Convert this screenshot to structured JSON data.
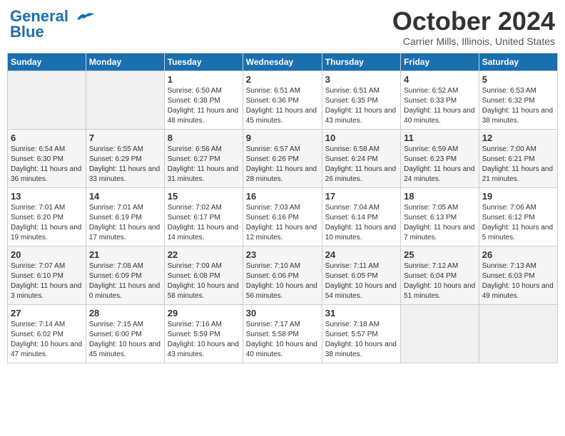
{
  "header": {
    "logo_general": "General",
    "logo_blue": "Blue",
    "month_title": "October 2024",
    "location": "Carrier Mills, Illinois, United States"
  },
  "days_of_week": [
    "Sunday",
    "Monday",
    "Tuesday",
    "Wednesday",
    "Thursday",
    "Friday",
    "Saturday"
  ],
  "weeks": [
    [
      {
        "day": "",
        "info": ""
      },
      {
        "day": "",
        "info": ""
      },
      {
        "day": "1",
        "info": "Sunrise: 6:50 AM\nSunset: 6:38 PM\nDaylight: 11 hours and 48 minutes."
      },
      {
        "day": "2",
        "info": "Sunrise: 6:51 AM\nSunset: 6:36 PM\nDaylight: 11 hours and 45 minutes."
      },
      {
        "day": "3",
        "info": "Sunrise: 6:51 AM\nSunset: 6:35 PM\nDaylight: 11 hours and 43 minutes."
      },
      {
        "day": "4",
        "info": "Sunrise: 6:52 AM\nSunset: 6:33 PM\nDaylight: 11 hours and 40 minutes."
      },
      {
        "day": "5",
        "info": "Sunrise: 6:53 AM\nSunset: 6:32 PM\nDaylight: 11 hours and 38 minutes."
      }
    ],
    [
      {
        "day": "6",
        "info": "Sunrise: 6:54 AM\nSunset: 6:30 PM\nDaylight: 11 hours and 36 minutes."
      },
      {
        "day": "7",
        "info": "Sunrise: 6:55 AM\nSunset: 6:29 PM\nDaylight: 11 hours and 33 minutes."
      },
      {
        "day": "8",
        "info": "Sunrise: 6:56 AM\nSunset: 6:27 PM\nDaylight: 11 hours and 31 minutes."
      },
      {
        "day": "9",
        "info": "Sunrise: 6:57 AM\nSunset: 6:26 PM\nDaylight: 11 hours and 28 minutes."
      },
      {
        "day": "10",
        "info": "Sunrise: 6:58 AM\nSunset: 6:24 PM\nDaylight: 11 hours and 26 minutes."
      },
      {
        "day": "11",
        "info": "Sunrise: 6:59 AM\nSunset: 6:23 PM\nDaylight: 11 hours and 24 minutes."
      },
      {
        "day": "12",
        "info": "Sunrise: 7:00 AM\nSunset: 6:21 PM\nDaylight: 11 hours and 21 minutes."
      }
    ],
    [
      {
        "day": "13",
        "info": "Sunrise: 7:01 AM\nSunset: 6:20 PM\nDaylight: 11 hours and 19 minutes."
      },
      {
        "day": "14",
        "info": "Sunrise: 7:01 AM\nSunset: 6:19 PM\nDaylight: 11 hours and 17 minutes."
      },
      {
        "day": "15",
        "info": "Sunrise: 7:02 AM\nSunset: 6:17 PM\nDaylight: 11 hours and 14 minutes."
      },
      {
        "day": "16",
        "info": "Sunrise: 7:03 AM\nSunset: 6:16 PM\nDaylight: 11 hours and 12 minutes."
      },
      {
        "day": "17",
        "info": "Sunrise: 7:04 AM\nSunset: 6:14 PM\nDaylight: 11 hours and 10 minutes."
      },
      {
        "day": "18",
        "info": "Sunrise: 7:05 AM\nSunset: 6:13 PM\nDaylight: 11 hours and 7 minutes."
      },
      {
        "day": "19",
        "info": "Sunrise: 7:06 AM\nSunset: 6:12 PM\nDaylight: 11 hours and 5 minutes."
      }
    ],
    [
      {
        "day": "20",
        "info": "Sunrise: 7:07 AM\nSunset: 6:10 PM\nDaylight: 11 hours and 3 minutes."
      },
      {
        "day": "21",
        "info": "Sunrise: 7:08 AM\nSunset: 6:09 PM\nDaylight: 11 hours and 0 minutes."
      },
      {
        "day": "22",
        "info": "Sunrise: 7:09 AM\nSunset: 6:08 PM\nDaylight: 10 hours and 58 minutes."
      },
      {
        "day": "23",
        "info": "Sunrise: 7:10 AM\nSunset: 6:06 PM\nDaylight: 10 hours and 56 minutes."
      },
      {
        "day": "24",
        "info": "Sunrise: 7:11 AM\nSunset: 6:05 PM\nDaylight: 10 hours and 54 minutes."
      },
      {
        "day": "25",
        "info": "Sunrise: 7:12 AM\nSunset: 6:04 PM\nDaylight: 10 hours and 51 minutes."
      },
      {
        "day": "26",
        "info": "Sunrise: 7:13 AM\nSunset: 6:03 PM\nDaylight: 10 hours and 49 minutes."
      }
    ],
    [
      {
        "day": "27",
        "info": "Sunrise: 7:14 AM\nSunset: 6:02 PM\nDaylight: 10 hours and 47 minutes."
      },
      {
        "day": "28",
        "info": "Sunrise: 7:15 AM\nSunset: 6:00 PM\nDaylight: 10 hours and 45 minutes."
      },
      {
        "day": "29",
        "info": "Sunrise: 7:16 AM\nSunset: 5:59 PM\nDaylight: 10 hours and 43 minutes."
      },
      {
        "day": "30",
        "info": "Sunrise: 7:17 AM\nSunset: 5:58 PM\nDaylight: 10 hours and 40 minutes."
      },
      {
        "day": "31",
        "info": "Sunrise: 7:18 AM\nSunset: 5:57 PM\nDaylight: 10 hours and 38 minutes."
      },
      {
        "day": "",
        "info": ""
      },
      {
        "day": "",
        "info": ""
      }
    ]
  ]
}
